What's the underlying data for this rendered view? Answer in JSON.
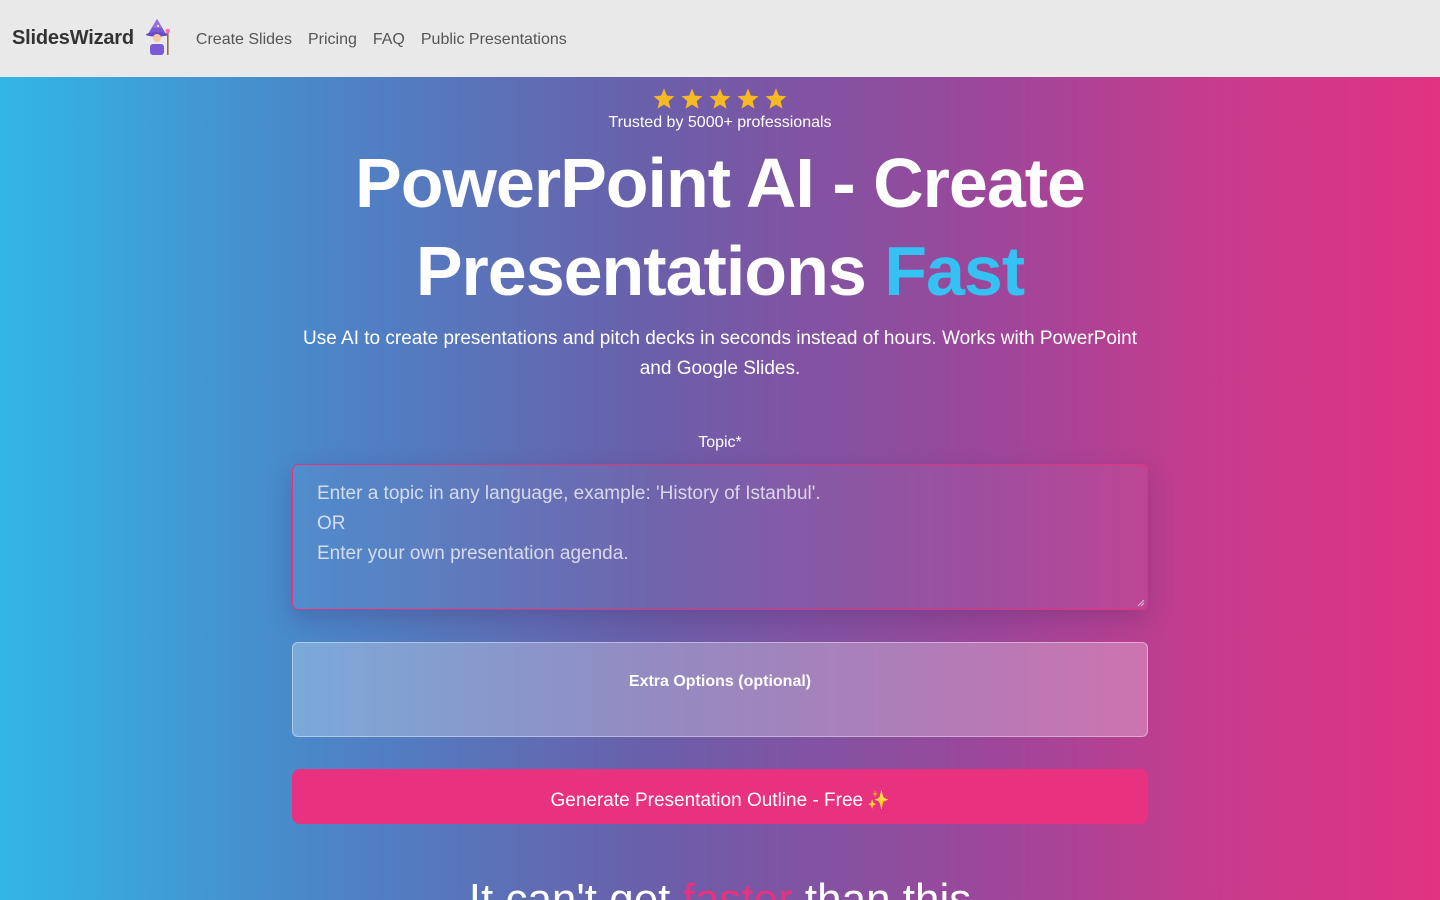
{
  "nav": {
    "brand": "SlidesWizard",
    "links": [
      "Create Slides",
      "Pricing",
      "FAQ",
      "Public Presentations"
    ]
  },
  "hero": {
    "rating_stars": 5,
    "trusted_text": "Trusted by 5000+ professionals",
    "headline_line1": "PowerPoint AI - Create",
    "headline_line2_main": "Presentations ",
    "headline_line2_accent": "Fast",
    "subtitle": "Use AI to create presentations and pitch decks in seconds instead of hours. Works with PowerPoint and Google Slides.",
    "topic_label": "Topic*",
    "topic_placeholder_lines": [
      "Enter a topic in any language, example: 'History of Istanbul'.",
      "OR",
      "Enter your own presentation agenda."
    ],
    "topic_value": "",
    "extra_options_label": "Extra Options (optional)",
    "generate_label": "Generate Presentation Outline - Free",
    "generate_emoji": "✨",
    "bottom_heading_part1": "It can't get ",
    "bottom_heading_accent": "faster",
    "bottom_heading_part2": " than this"
  },
  "colors": {
    "accent_pink": "#e8317f",
    "accent_blue": "#35c1f1",
    "star": "#f5b921"
  },
  "icons": {
    "logo": "wizard-icon",
    "star": "star-icon",
    "sparkle": "sparkles-icon"
  }
}
